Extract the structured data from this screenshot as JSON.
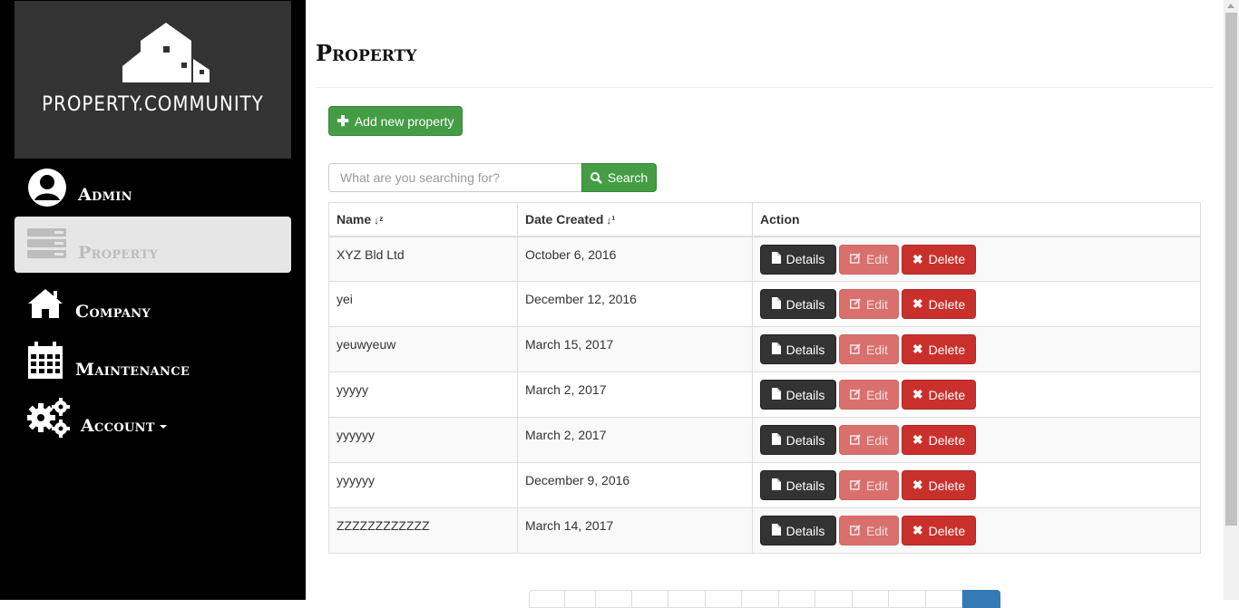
{
  "brand": {
    "name": "PROPERTY.COMMUNITY"
  },
  "sidebar": {
    "items": [
      {
        "label": "Admin",
        "icon": "user-circle-icon"
      },
      {
        "label": "Property",
        "icon": "server-icon"
      },
      {
        "label": "Company",
        "icon": "home-icon"
      },
      {
        "label": "Maintenance",
        "icon": "calendar-icon"
      },
      {
        "label": "Account",
        "icon": "gears-icon"
      }
    ]
  },
  "page": {
    "title": "Property",
    "add_button_label": "Add new property",
    "search": {
      "placeholder": "What are you searching for?",
      "button_label": "Search"
    }
  },
  "table": {
    "columns": [
      "Name",
      "Date Created",
      "Action"
    ],
    "rows": [
      {
        "name": "XYZ Bld Ltd",
        "date": "October 6, 2016"
      },
      {
        "name": "yei",
        "date": "December 12, 2016"
      },
      {
        "name": "yeuwyeuw",
        "date": "March 15, 2017"
      },
      {
        "name": "yyyyy",
        "date": "March 2, 2017"
      },
      {
        "name": "yyyyyy",
        "date": "March 2, 2017"
      },
      {
        "name": "yyyyyy",
        "date": "December 9, 2016"
      },
      {
        "name": "ZZZZZZZZZZZZ",
        "date": "March 14, 2017"
      }
    ],
    "actions": {
      "details": "Details",
      "edit": "Edit",
      "delete": "Delete"
    }
  },
  "colors": {
    "accent_green": "#449d44",
    "danger": "#c9302c",
    "dark": "#333333",
    "sidebar_bg": "#000000"
  }
}
